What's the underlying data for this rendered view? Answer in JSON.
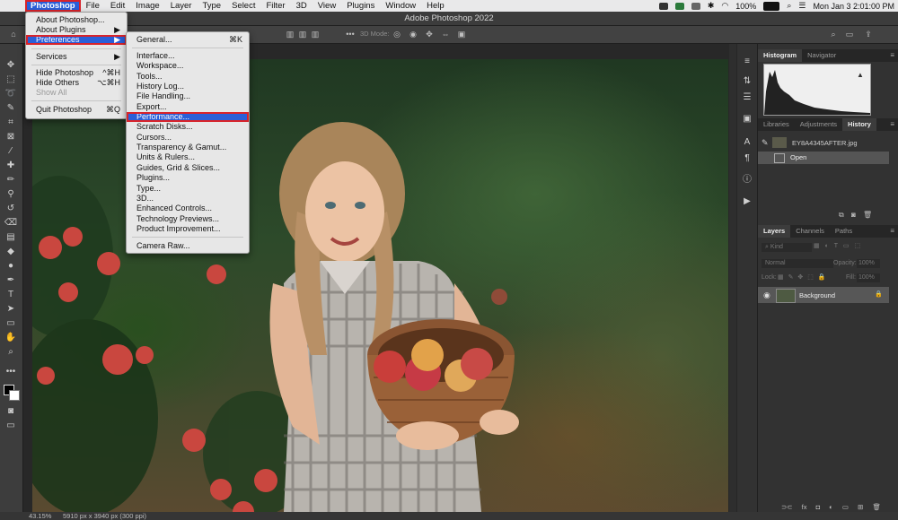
{
  "menubar": {
    "apple": "",
    "items": [
      "Photoshop",
      "File",
      "Edit",
      "Image",
      "Layer",
      "Type",
      "Select",
      "Filter",
      "3D",
      "View",
      "Plugins",
      "Window",
      "Help"
    ],
    "status": {
      "battery": "100%",
      "datetime": "Mon Jan 3  2:01:00 PM"
    }
  },
  "app_title": "Adobe Photoshop 2022",
  "optionsbar": {
    "mode_label": "3D Mode:"
  },
  "photoshop_menu": {
    "items": [
      {
        "label": "About Photoshop...",
        "shortcut": ""
      },
      {
        "label": "About Plugins",
        "shortcut": "▶"
      },
      {
        "label": "Preferences",
        "shortcut": "▶"
      },
      {
        "label": "Services",
        "shortcut": "▶"
      },
      {
        "label": "Hide Photoshop",
        "shortcut": "^⌘H"
      },
      {
        "label": "Hide Others",
        "shortcut": "⌥⌘H"
      },
      {
        "label": "Show All",
        "shortcut": ""
      },
      {
        "label": "Quit Photoshop",
        "shortcut": "⌘Q"
      }
    ]
  },
  "preferences_menu": {
    "items": [
      {
        "label": "General...",
        "shortcut": "⌘K"
      },
      {
        "label": "Interface...",
        "shortcut": ""
      },
      {
        "label": "Workspace...",
        "shortcut": ""
      },
      {
        "label": "Tools...",
        "shortcut": ""
      },
      {
        "label": "History Log...",
        "shortcut": ""
      },
      {
        "label": "File Handling...",
        "shortcut": ""
      },
      {
        "label": "Export...",
        "shortcut": ""
      },
      {
        "label": "Performance...",
        "shortcut": ""
      },
      {
        "label": "Scratch Disks...",
        "shortcut": ""
      },
      {
        "label": "Cursors...",
        "shortcut": ""
      },
      {
        "label": "Transparency & Gamut...",
        "shortcut": ""
      },
      {
        "label": "Units & Rulers...",
        "shortcut": ""
      },
      {
        "label": "Guides, Grid & Slices...",
        "shortcut": ""
      },
      {
        "label": "Plugins...",
        "shortcut": ""
      },
      {
        "label": "Type...",
        "shortcut": ""
      },
      {
        "label": "3D...",
        "shortcut": ""
      },
      {
        "label": "Enhanced Controls...",
        "shortcut": ""
      },
      {
        "label": "Technology Previews...",
        "shortcut": ""
      },
      {
        "label": "Product Improvement...",
        "shortcut": ""
      },
      {
        "label": "Camera Raw...",
        "shortcut": ""
      }
    ]
  },
  "panels": {
    "top_tabs": [
      "Histogram",
      "Navigator"
    ],
    "mid_tabs": [
      "Libraries",
      "Adjustments",
      "History"
    ],
    "history": {
      "snapshot": "EY8A4345AFTER.jpg",
      "step": "Open"
    },
    "layer_tabs": [
      "Layers",
      "Channels",
      "Paths"
    ],
    "layers": {
      "filter_placeholder": "Kind",
      "blend_mode": "Normal",
      "opacity_label": "Opacity:",
      "opacity_value": "100%",
      "lock_label": "Lock:",
      "fill_label": "Fill:",
      "fill_value": "100%",
      "layer_name": "Background"
    }
  },
  "status_bar": {
    "zoom": "43.15%",
    "doc_info": "5910 px x 3940 px (300 ppi)"
  },
  "colors": {
    "accent": "#2a5fd8",
    "highlight_outline": "#d8232a"
  }
}
